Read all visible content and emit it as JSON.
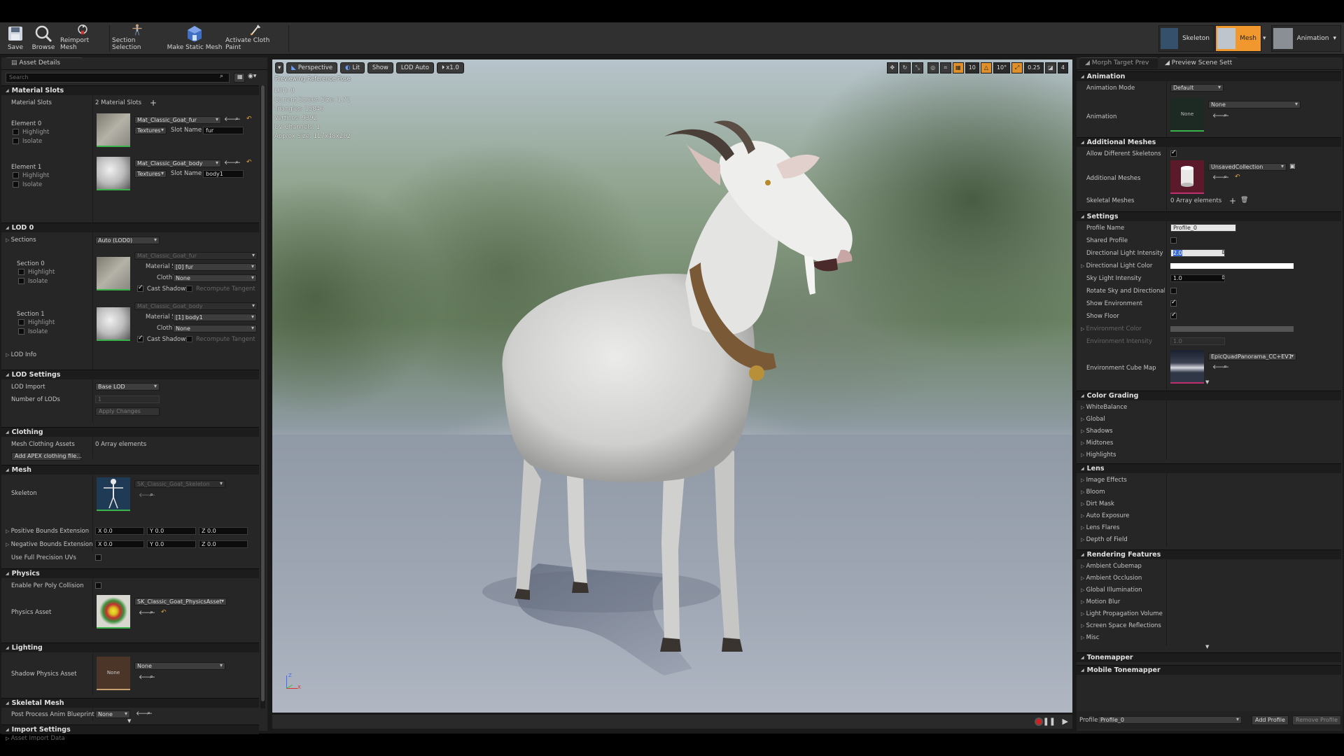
{
  "toolbar": {
    "buttons": [
      {
        "label": "Save",
        "icon": "save-icon"
      },
      {
        "label": "Browse",
        "icon": "browse-icon"
      },
      {
        "label": "Reimport Mesh",
        "icon": "reimport-icon"
      },
      {
        "label": "Section Selection",
        "icon": "section-selection-icon"
      },
      {
        "label": "Make Static Mesh",
        "icon": "make-static-mesh-icon"
      },
      {
        "label": "Activate Cloth Paint",
        "icon": "cloth-paint-icon"
      }
    ],
    "modes": {
      "skeleton": "Skeleton",
      "mesh": "Mesh",
      "animation": "Animation"
    },
    "accent": "#f0982e"
  },
  "left": {
    "tab": "Asset Details",
    "search_placeholder": "Search",
    "material_slots": {
      "category": "Material Slots",
      "label": "Material Slots",
      "count": "2 Material Slots",
      "elements": [
        {
          "name": "Element 0",
          "highlight": "Highlight",
          "isolate": "Isolate",
          "material": "Mat_Classic_Goat_fur",
          "textures": "Textures",
          "slot_label": "Slot Name",
          "slot_value": "fur"
        },
        {
          "name": "Element 1",
          "highlight": "Highlight",
          "isolate": "Isolate",
          "material": "Mat_Classic_Goat_body",
          "textures": "Textures",
          "slot_label": "Slot Name",
          "slot_value": "body1"
        }
      ]
    },
    "lod0": {
      "category": "LOD 0",
      "sections_label": "Sections",
      "sections_value": "Auto (LOD0)",
      "sections": [
        {
          "name": "Section 0",
          "highlight": "Highlight",
          "isolate": "Isolate",
          "material": "Mat_Classic_Goat_fur",
          "slot_label": "Material Slot",
          "slot_value": "[0] fur",
          "clothing_label": "Clothing",
          "clothing_value": "None",
          "cast_shadows": "Cast Shadows",
          "recompute": "Recompute Tangent"
        },
        {
          "name": "Section 1",
          "highlight": "Highlight",
          "isolate": "Isolate",
          "material": "Mat_Classic_Goat_body",
          "slot_label": "Material Slot",
          "slot_value": "[1] body1",
          "clothing_label": "Clothing",
          "clothing_value": "None",
          "cast_shadows": "Cast Shadows",
          "recompute": "Recompute Tangent"
        }
      ],
      "lod_info": "LOD Info"
    },
    "lod_settings": {
      "category": "LOD Settings",
      "lod_import_label": "LOD Import",
      "lod_import_value": "Base LOD",
      "num_lods_label": "Number of LODs",
      "num_lods_value": "1",
      "apply": "Apply Changes"
    },
    "clothing": {
      "category": "Clothing",
      "assets_label": "Mesh Clothing Assets",
      "assets_value": "0 Array elements",
      "add_button": "Add APEX clothing file..."
    },
    "mesh": {
      "category": "Mesh",
      "skeleton_label": "Skeleton",
      "skeleton_value": "SK_Classic_Goat_Skeleton",
      "pos_bounds_label": "Positive Bounds Extension",
      "neg_bounds_label": "Negative Bounds Extension",
      "x_label": "X",
      "y_label": "Y",
      "z_label": "Z",
      "zero": "0.0",
      "full_precision_label": "Use Full Precision UVs"
    },
    "physics": {
      "category": "Physics",
      "per_poly_label": "Enable Per Poly Collision",
      "asset_label": "Physics Asset",
      "asset_value": "SK_Classic_Goat_PhysicsAsset"
    },
    "lighting": {
      "category": "Lighting",
      "shadow_label": "Shadow Physics Asset",
      "shadow_value": "None",
      "thumb_text": "None"
    },
    "skeletal_mesh": {
      "category": "Skeletal Mesh",
      "post_process_label": "Post Process Anim Blueprint",
      "post_process_value": "None"
    },
    "import_settings": {
      "category": "Import Settings",
      "asset_import_data": "Asset Import Data"
    }
  },
  "viewport": {
    "menu_icon": "▾",
    "perspective": "Perspective",
    "lit": "Lit",
    "show": "Show",
    "lod_auto": "LOD Auto",
    "speed": "x1.0",
    "grid_snap": "10",
    "rot_snap": "10°",
    "scale_snap": "0.25",
    "cam_speed": "4",
    "preview_text": "Previewing Reference Pose",
    "info": [
      "LOD: 0",
      "Current Screen Size: 1.71",
      "Triangles: 15846",
      "Vertices: 9392",
      "UV Channels: 1",
      "Approx Size: 117x48x202"
    ],
    "axis_z": "Z",
    "axis_x": "X"
  },
  "right": {
    "tabs": [
      "Morph Target Prev",
      "Preview Scene Sett"
    ],
    "animation": {
      "category": "Animation",
      "mode_label": "Animation Mode",
      "mode_value": "Default",
      "anim_label": "Animation",
      "anim_value": "None",
      "thumb_text": "None"
    },
    "additional_meshes": {
      "category": "Additional Meshes",
      "allow_label": "Allow Different Skeletons",
      "meshes_label": "Additional Meshes",
      "meshes_value": "UnsavedCollection",
      "skeletal_label": "Skeletal Meshes",
      "skeletal_value": "0 Array elements"
    },
    "settings": {
      "category": "Settings",
      "profile_name_label": "Profile Name",
      "profile_name_value": "Profile_0",
      "shared_label": "Shared Profile",
      "dir_intensity_label": "Directional Light Intensity",
      "dir_intensity_value": "2.0",
      "dir_color_label": "Directional Light Color",
      "sky_label": "Sky Light Intensity",
      "sky_value": "1.0",
      "rotate_label": "Rotate Sky and Directional Ligh",
      "show_env_label": "Show Environment",
      "show_floor_label": "Show Floor",
      "env_color_label": "Environment Color",
      "env_intensity_label": "Environment Intensity",
      "env_intensity_value": "1.0",
      "cubemap_label": "Environment Cube Map",
      "cubemap_value": "EpicQuadPanorama_CC+EV1"
    },
    "color_grading": {
      "category": "Color Grading",
      "items": [
        "WhiteBalance",
        "Global",
        "Shadows",
        "Midtones",
        "Highlights"
      ]
    },
    "lens": {
      "category": "Lens",
      "items": [
        "Image Effects",
        "Bloom",
        "Dirt Mask",
        "Auto Exposure",
        "Lens Flares",
        "Depth of Field"
      ]
    },
    "rendering": {
      "category": "Rendering Features",
      "items": [
        "Ambient Cubemap",
        "Ambient Occlusion",
        "Global Illumination",
        "Motion Blur",
        "Light Propagation Volume",
        "Screen Space Reflections",
        "Misc"
      ]
    },
    "tonemapper": "Tonemapper",
    "mobile_tonemapper": "Mobile Tonemapper",
    "footer": {
      "profile_label": "Profile",
      "profile_value": "Profile_0",
      "add": "Add Profile",
      "remove": "Remove Profile"
    }
  }
}
